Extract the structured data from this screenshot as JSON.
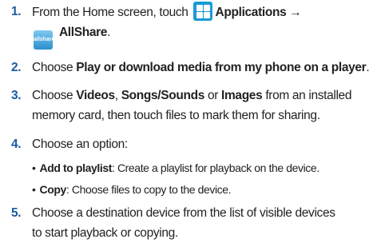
{
  "steps": [
    {
      "num": "1.",
      "pre": "From the Home screen, touch",
      "apps_label": "Applications →",
      "allshare_label": "AllShare",
      "end": ".",
      "icon_text": "allshare"
    },
    {
      "num": "2.",
      "pre": "Choose",
      "bold": "Play or download media from my phone on a player",
      "end": "."
    },
    {
      "num": "3.",
      "pre": "Choose",
      "b1": "Videos",
      "s1": ",",
      "b2": "Songs/Sounds",
      "s2": "or",
      "b3": "Images",
      "line1_end": "from an installed",
      "line2": "memory card, then touch files to mark them for sharing."
    },
    {
      "num": "4.",
      "text": "Choose an option:"
    },
    {
      "num": "5.",
      "line1": "Choose a destination device from the list of visible devices",
      "line2": "to start playback or copying."
    }
  ],
  "options": [
    {
      "label": "Add to playlist",
      "desc": ": Create a playlist for playback on the device."
    },
    {
      "label": "Copy",
      "desc": ": Choose files to copy to the device."
    }
  ],
  "colors": {
    "number": "#1a5aa0",
    "apps_icon": "#1b9ad6"
  }
}
